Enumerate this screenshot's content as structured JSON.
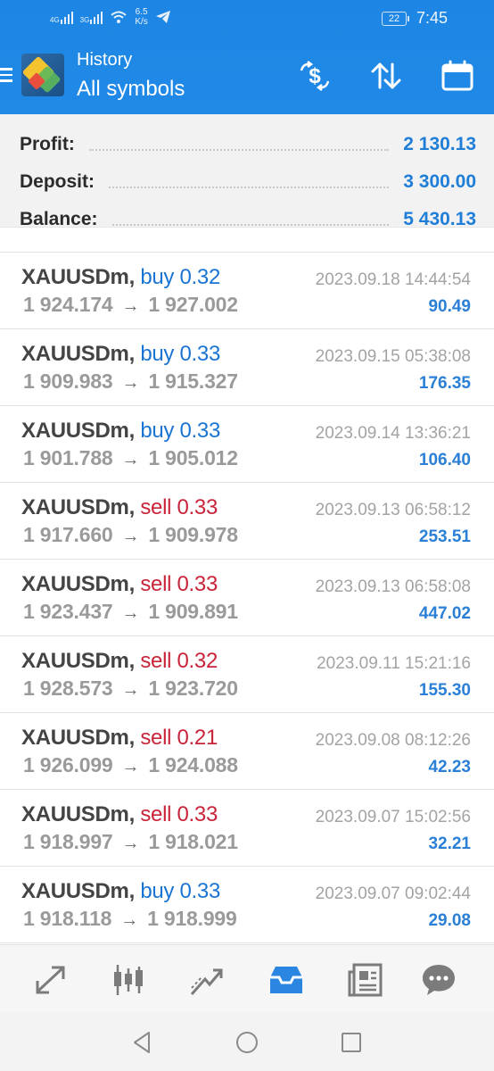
{
  "status_bar": {
    "signal1": "4G",
    "signal2": "3G",
    "speed_value": "6.5",
    "speed_unit": "K/s",
    "battery": "22",
    "time": "7:45"
  },
  "header": {
    "title": "History",
    "subtitle": "All symbols",
    "icons": [
      "exchange-dollar-icon",
      "sort-icon",
      "calendar-icon"
    ]
  },
  "summary": {
    "profit_label": "Profit:",
    "profit_value": "2 130.13",
    "deposit_label": "Deposit:",
    "deposit_value": "3 300.00",
    "balance_label": "Balance:",
    "balance_value": "5 430.13"
  },
  "colors": {
    "accent": "#1f88e5",
    "buy": "#1a74d4",
    "sell": "#c8243a",
    "profit": "#2a7fd6"
  },
  "deals": [
    {
      "symbol": "XAUUSDm,",
      "type": "buy 0.32",
      "side": "buy",
      "open": "1 924.174",
      "close": "1 927.002",
      "time": "2023.09.18 14:44:54",
      "profit": "90.49"
    },
    {
      "symbol": "XAUUSDm,",
      "type": "buy 0.33",
      "side": "buy",
      "open": "1 909.983",
      "close": "1 915.327",
      "time": "2023.09.15 05:38:08",
      "profit": "176.35"
    },
    {
      "symbol": "XAUUSDm,",
      "type": "buy 0.33",
      "side": "buy",
      "open": "1 901.788",
      "close": "1 905.012",
      "time": "2023.09.14 13:36:21",
      "profit": "106.40"
    },
    {
      "symbol": "XAUUSDm,",
      "type": "sell 0.33",
      "side": "sell",
      "open": "1 917.660",
      "close": "1 909.978",
      "time": "2023.09.13 06:58:12",
      "profit": "253.51"
    },
    {
      "symbol": "XAUUSDm,",
      "type": "sell 0.33",
      "side": "sell",
      "open": "1 923.437",
      "close": "1 909.891",
      "time": "2023.09.13 06:58:08",
      "profit": "447.02"
    },
    {
      "symbol": "XAUUSDm,",
      "type": "sell 0.32",
      "side": "sell",
      "open": "1 928.573",
      "close": "1 923.720",
      "time": "2023.09.11 15:21:16",
      "profit": "155.30"
    },
    {
      "symbol": "XAUUSDm,",
      "type": "sell 0.21",
      "side": "sell",
      "open": "1 926.099",
      "close": "1 924.088",
      "time": "2023.09.08 08:12:26",
      "profit": "42.23"
    },
    {
      "symbol": "XAUUSDm,",
      "type": "sell 0.33",
      "side": "sell",
      "open": "1 918.997",
      "close": "1 918.021",
      "time": "2023.09.07 15:02:56",
      "profit": "32.21"
    },
    {
      "symbol": "XAUUSDm,",
      "type": "buy 0.33",
      "side": "buy",
      "open": "1 918.118",
      "close": "1 918.999",
      "time": "2023.09.07 09:02:44",
      "profit": "29.08"
    }
  ],
  "arrow_glyph": "→",
  "bottom_nav": [
    "quotes-icon",
    "chart-icon",
    "trade-icon",
    "history-icon",
    "news-icon",
    "messages-icon"
  ],
  "bottom_nav_active": "history-icon",
  "system_nav": [
    "back-icon",
    "home-icon",
    "recents-icon"
  ]
}
